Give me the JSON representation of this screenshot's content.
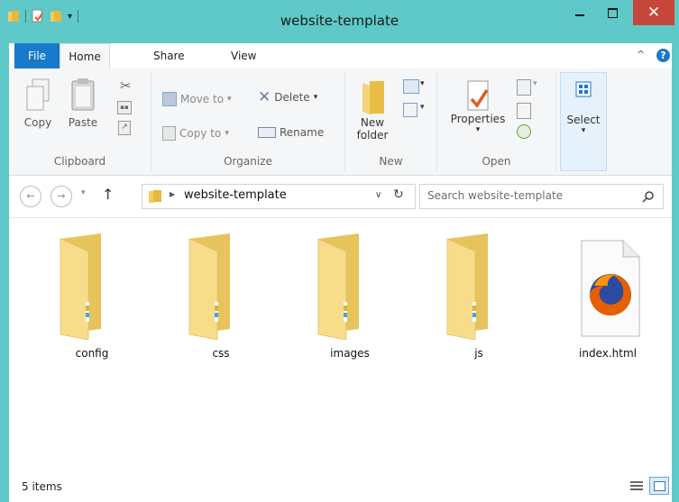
{
  "window": {
    "title": "website-template",
    "controls": {
      "minimize": "—",
      "maximize": "☐",
      "close": "✕"
    }
  },
  "ribbon": {
    "tabs": [
      "File",
      "Home",
      "Share",
      "View"
    ],
    "help": "?",
    "groups": {
      "clipboard": {
        "label": "Clipboard",
        "copy": "Copy",
        "paste": "Paste"
      },
      "organize": {
        "label": "Organize",
        "move_to": "Move to",
        "copy_to": "Copy to",
        "delete": "Delete",
        "rename": "Rename"
      },
      "new": {
        "label": "New",
        "new_folder_line1": "New",
        "new_folder_line2": "folder"
      },
      "open": {
        "label": "Open",
        "properties": "Properties"
      },
      "select": {
        "label": "Select"
      }
    }
  },
  "navigation": {
    "breadcrumb": "website-template",
    "search_placeholder": "Search website-template"
  },
  "files": [
    {
      "name": "config",
      "icon": "folder-icon"
    },
    {
      "name": "css",
      "icon": "folder-icon"
    },
    {
      "name": "images",
      "icon": "folder-icon"
    },
    {
      "name": "js",
      "icon": "folder-icon"
    },
    {
      "name": "index.html",
      "icon": "firefox-html-file-icon"
    }
  ],
  "status": {
    "item_count": "5 items"
  },
  "colors": {
    "titlebar": "#5ec9c8",
    "file_tab": "#1979ca",
    "close_button": "#c7473b",
    "folder": "#f0cf6b"
  }
}
